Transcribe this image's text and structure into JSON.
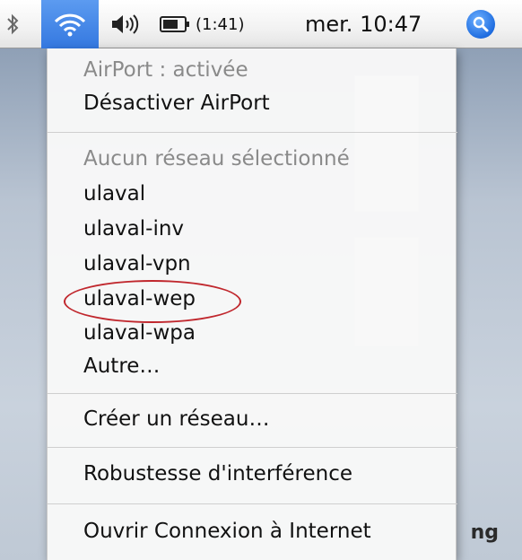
{
  "menubar": {
    "bluetooth_icon": "bluetooth-icon",
    "wifi_icon": "wifi-icon",
    "volume_icon": "volume-icon",
    "battery_icon": "battery-icon",
    "battery_time": "(1:41)",
    "clock": "mer. 10:47",
    "spotlight_icon": "spotlight-search-icon"
  },
  "menu": {
    "status": "AirPort : activée",
    "toggle": "Désactiver AirPort",
    "network_header": "Aucun réseau sélectionné",
    "networks": [
      "ulaval",
      "ulaval-inv",
      "ulaval-vpn",
      "ulaval-wep",
      "ulaval-wpa"
    ],
    "other": "Autre…",
    "create_network": "Créer un réseau…",
    "interference": "Robustesse d'interférence",
    "open_connect": "Ouvrir Connexion à Internet"
  },
  "desktop": {
    "partial_text": "ng"
  },
  "colors": {
    "highlight": "#3478e0",
    "annotation": "#c0272d"
  }
}
